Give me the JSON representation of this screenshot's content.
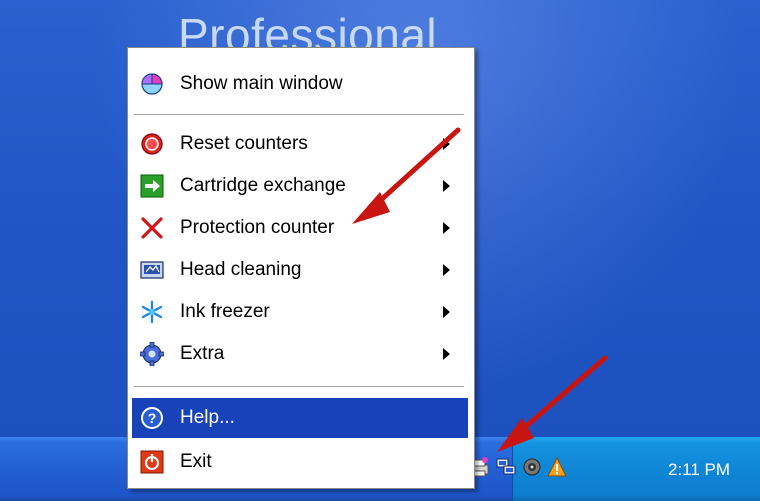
{
  "desktop": {
    "wallpaper_text": "Professional"
  },
  "menu": {
    "items": [
      {
        "label": "Show main window",
        "icon": "pie-chart-icon",
        "has_submenu": false
      },
      {
        "label": "Reset counters",
        "icon": "red-circle-icon",
        "has_submenu": true
      },
      {
        "label": "Cartridge exchange",
        "icon": "green-arrow-icon",
        "has_submenu": true
      },
      {
        "label": "Protection counter",
        "icon": "red-x-icon",
        "has_submenu": true
      },
      {
        "label": "Head cleaning",
        "icon": "printhead-icon",
        "has_submenu": true
      },
      {
        "label": "Ink freezer",
        "icon": "snowflake-icon",
        "has_submenu": true
      },
      {
        "label": "Extra",
        "icon": "gear-icon",
        "has_submenu": true
      },
      {
        "label": "Help...",
        "icon": "help-icon",
        "has_submenu": false,
        "highlighted": true
      },
      {
        "label": "Exit",
        "icon": "power-icon",
        "has_submenu": false
      }
    ]
  },
  "taskbar": {
    "clock": "2:11 PM",
    "tray_icons": [
      "printer-app-icon",
      "network-icon",
      "volume-icon",
      "update-icon"
    ]
  },
  "colors": {
    "highlight": "#1742b8",
    "annotation_arrow": "#c8150f"
  }
}
